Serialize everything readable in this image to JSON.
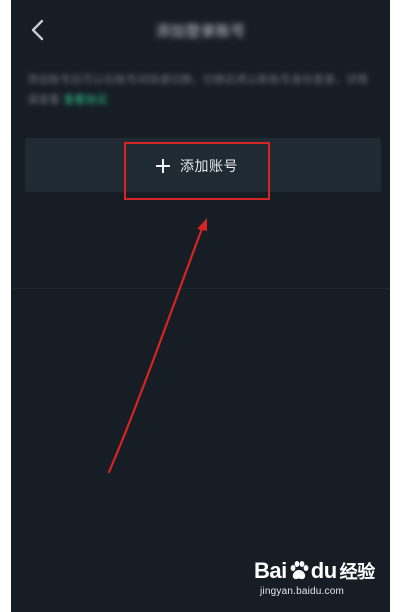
{
  "nav": {
    "title": "添加登录账号",
    "back_icon": "chevron-left-icon"
  },
  "description": {
    "text": "添加账号后可以在账号间快速切换，切换后将以新账号身份登录，详情请查看",
    "link_text": "查看协议"
  },
  "add_account": {
    "label": "添加账号",
    "icon": "plus-icon"
  },
  "watermark": {
    "brand_prefix": "Bai",
    "brand_middle": "du",
    "brand_suffix": "经验",
    "url": "jingyan.baidu.com"
  },
  "colors": {
    "background": "#161d25",
    "card": "#1f2a32",
    "accent_link": "#2fc28a",
    "annotation": "#d52424"
  }
}
